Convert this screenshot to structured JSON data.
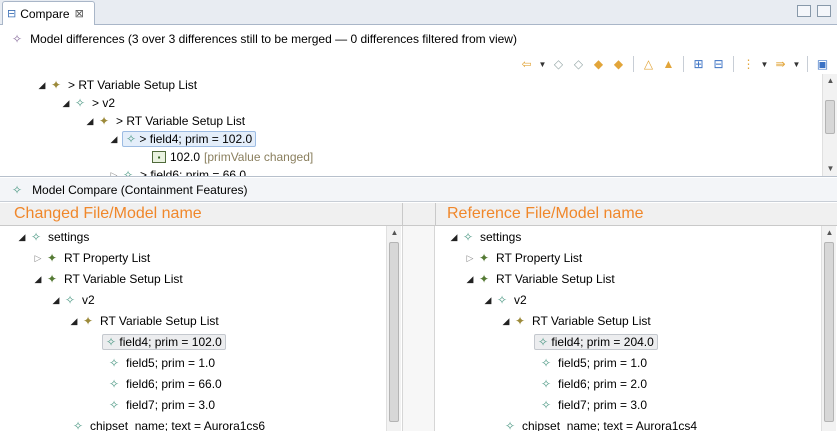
{
  "tab": {
    "title": "Compare",
    "close": "⊠"
  },
  "header": {
    "title": "Model differences  (3 over 3 differences still to be merged — 0 differences filtered from view)"
  },
  "toolbar": {
    "colors": {
      "merge": "#e2a53a",
      "nav": "#3b72c4",
      "disabled": "#9aa"
    }
  },
  "diff_tree": {
    "rows": [
      {
        "text": "> RT Variable Setup List"
      },
      {
        "text": "> v2"
      },
      {
        "text": "> RT Variable Setup List"
      },
      {
        "text": "> field4; prim = 102.0"
      },
      {
        "text": "102.0",
        "change": "[primValue changed]"
      },
      {
        "text": "> field6; prim = 66.0"
      }
    ]
  },
  "compare_header": {
    "title": "Model Compare (Containment Features)"
  },
  "left_pane": {
    "title": "Changed File/Model name",
    "rows": [
      {
        "text": "settings"
      },
      {
        "text": "RT Property List"
      },
      {
        "text": "RT Variable Setup List"
      },
      {
        "text": "v2"
      },
      {
        "text": "RT Variable Setup List"
      },
      {
        "text": "field4; prim = 102.0"
      },
      {
        "text": "field5; prim = 1.0"
      },
      {
        "text": "field6; prim = 66.0"
      },
      {
        "text": "field7; prim = 3.0"
      },
      {
        "text": "chipset_name; text = Aurora1cs6"
      }
    ]
  },
  "right_pane": {
    "title": "Reference File/Model name",
    "rows": [
      {
        "text": "settings"
      },
      {
        "text": "RT Property List"
      },
      {
        "text": "RT Variable Setup List"
      },
      {
        "text": "v2"
      },
      {
        "text": "RT Variable Setup List"
      },
      {
        "text": "field4; prim = 204.0"
      },
      {
        "text": "field5; prim = 1.0"
      },
      {
        "text": "field6; prim = 2.0"
      },
      {
        "text": "field7; prim = 3.0"
      },
      {
        "text": "chipset_name; text = Aurora1cs4"
      }
    ]
  },
  "colors": {
    "pane_title": "#f0872a",
    "selection": "#e4eefa"
  }
}
